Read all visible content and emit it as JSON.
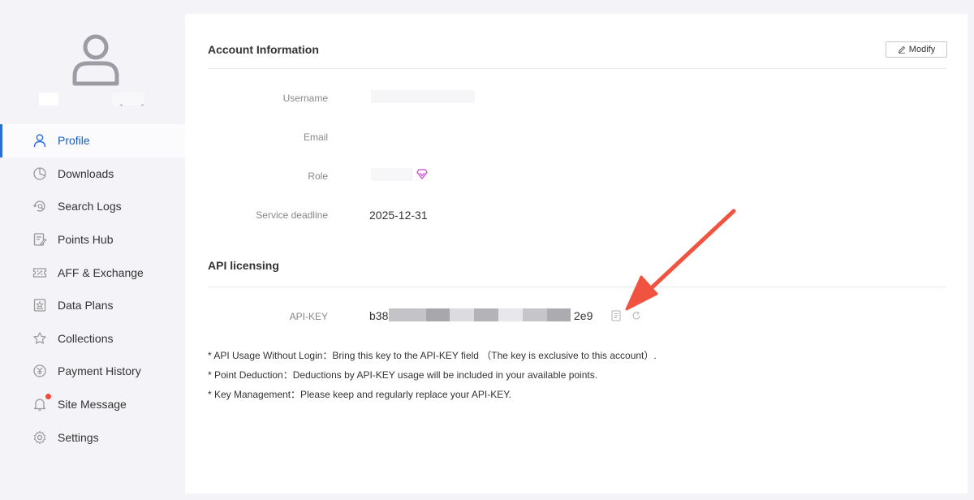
{
  "sidebar": {
    "items": [
      {
        "label": "Profile",
        "icon": "user-icon",
        "active": true
      },
      {
        "label": "Downloads",
        "icon": "pie-chart-icon"
      },
      {
        "label": "Search Logs",
        "icon": "search-history-icon"
      },
      {
        "label": "Points Hub",
        "icon": "edit-document-icon"
      },
      {
        "label": "AFF & Exchange",
        "icon": "ticket-icon"
      },
      {
        "label": "Data Plans",
        "icon": "bookmark-star-icon"
      },
      {
        "label": "Collections",
        "icon": "star-icon"
      },
      {
        "label": "Payment History",
        "icon": "yen-circle-icon"
      },
      {
        "label": "Site Message",
        "icon": "bell-icon",
        "has_badge": true
      },
      {
        "label": "Settings",
        "icon": "gear-icon"
      }
    ]
  },
  "account": {
    "title": "Account Information",
    "modify_label": "Modify",
    "username_label": "Username",
    "email_label": "Email",
    "role_label": "Role",
    "deadline_label": "Service deadline",
    "deadline_value": "2025-12-31"
  },
  "api": {
    "title": "API licensing",
    "key_label": "API-KEY",
    "key_prefix": "b38",
    "key_suffix": "2e9",
    "notes": [
      "* API Usage Without Login：Bring this key to the API-KEY field （The key is exclusive to this account）.",
      "* Point Deduction：Deductions by API-KEY usage will be included in your available points.",
      "* Key Management：Please keep and regularly replace your API-KEY."
    ]
  },
  "colors": {
    "accent": "#2a6fd6",
    "badge": "#f04c3e",
    "annotation_arrow": "#f0533f",
    "role_icon": "#c43fd6"
  }
}
